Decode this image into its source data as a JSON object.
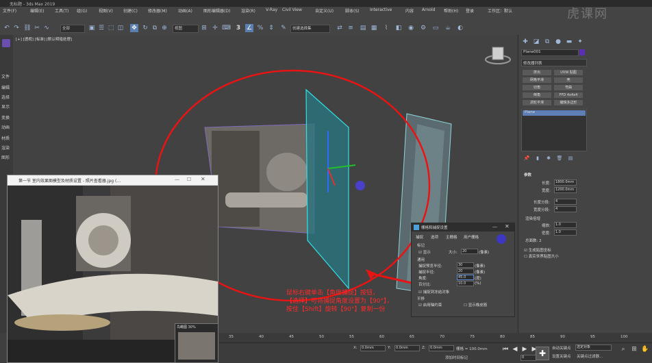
{
  "title_bar": {
    "title": "无标题 - 3ds Max 2019"
  },
  "watermark": "虎课网",
  "menu": {
    "file_edit": "文件(F)",
    "edit": "编辑(E)",
    "tools": "工具(T)",
    "group": "组(G)",
    "views": "视图(V)",
    "create": "创建(C)",
    "modifiers": "修改器(M)",
    "animation": "动画(A)",
    "graph": "图形编辑器(D)",
    "render": "渲染(R)",
    "vray": "V-Ray",
    "civil": "Civil View",
    "customize": "自定义(U)",
    "script": "脚本(S)",
    "interactive": "Interactive",
    "content": "内容",
    "arnold": "Arnold",
    "help": "帮助(H)",
    "login": "登录",
    "workspace": "工作区：默认"
  },
  "toolbar": {
    "filter": "全部",
    "view": "视图",
    "selection_set": "创建选择集",
    "snap_value": "3"
  },
  "left_tabs": [
    "文件",
    "编辑",
    "选择",
    "显示",
    "变换",
    "动画",
    "材质",
    "渲染",
    "图形"
  ],
  "viewport": {
    "label": "[+] [透视] [标准] [默认明暗处理]"
  },
  "photo_window": {
    "title": "第一节 室内效果图模型及材质设置 - 照片查看器.jpg (…",
    "zoom": "100%"
  },
  "aerial_view": {
    "title": "鸟瞰图 30%"
  },
  "dialog": {
    "title": "栅格和捕捉设置",
    "tabs": [
      "捕捉",
      "选项",
      "主栅格",
      "用户栅格"
    ],
    "section_marker": "标记",
    "show_label": "显示",
    "size_label": "大小:",
    "size_value": "20",
    "size_unit": "(像素)",
    "section_general": "通用",
    "snap_preview_label": "捕捉预览半径:",
    "snap_preview_value": "30",
    "snap_radius_label": "捕捉半径:",
    "snap_radius_value": "20",
    "angle_label": "角度:",
    "angle_value": "45.0",
    "percent_label": "百分比:",
    "percent_value": "10.0",
    "pixel_unit": "(像素)",
    "deg_unit": "(度)",
    "pct_unit": "(%)",
    "frozen_label": "捕捉到冻结对象",
    "section_translate": "平移",
    "axis_constraint": "启用轴约束",
    "show_rubber_band": "显示橡皮筋"
  },
  "caption": {
    "line1": "鼠标右键单击【角度捕捉】按钮，",
    "line2": "【选择】可将捕捉角度设置为【90°】，",
    "line3": "按住【Shift】旋转【90°】复制一份"
  },
  "right_panel": {
    "object_name": "Plane001",
    "modifier_list": "修改器列表",
    "buttons": [
      "挤出",
      "UVW 贴图",
      "网格平滑",
      "壳",
      "切角",
      "弯曲",
      "倒角",
      "FFD 4x4x4",
      "涡轮平滑",
      "编辑多边形"
    ],
    "stack_item": "Plane",
    "rollout_params": "参数",
    "length_label": "长度:",
    "length_value": "1800.0mm",
    "width_label": "宽度:",
    "width_value": "1200.0mm",
    "length_segs_label": "长度分段:",
    "length_segs_value": "4",
    "width_segs_label": "宽度分段:",
    "width_segs_value": "4",
    "render_multipliers": "渲染倍增",
    "scale_label": "缩放:",
    "scale_value": "1.0",
    "density_label": "密度:",
    "density_value": "1.0",
    "total_faces": "总面数: 2",
    "gen_mapping": "生成贴图坐标",
    "real_world": "真实世界贴图大小"
  },
  "timeline": {
    "ticks": [
      "35",
      "40",
      "45",
      "50",
      "55",
      "60",
      "65",
      "70",
      "75",
      "80",
      "85",
      "90",
      "95",
      "100"
    ]
  },
  "status": {
    "x_label": "X:",
    "x_value": "0.0mm",
    "y_label": "Y:",
    "y_value": "0.0mm",
    "z_label": "Z:",
    "z_value": "0.0mm",
    "grid": "栅格 = 100.0mm",
    "add_time_tag": "添加时间标记",
    "auto_key": "自动关键点",
    "set_key": "设置关键点",
    "selected": "选定对象",
    "key_filters": "关键点过滤器...",
    "frame": "0"
  }
}
